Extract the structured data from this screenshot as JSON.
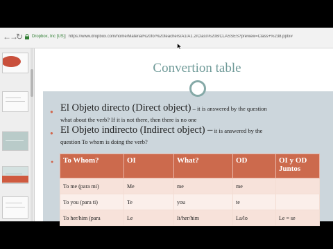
{
  "browser": {
    "back_icon": "arrow-left-icon",
    "forward_icon": "arrow-right-icon",
    "reload_icon": "reload-icon",
    "site_identity": "Dropbox, Inc [US]",
    "url": "https://www.dropbox.com/home/Material%20for%20teachers/A1/A1.2/Class%208/CLASSES?preview=Class+%238.pptx#"
  },
  "slide": {
    "title": "Convertion table",
    "bullets": [
      {
        "heading": "El Objeto directo (Direct object)",
        "tail": " – it is answered by the question",
        "line2": "what about the verb? If it is not there, then there is no one"
      },
      {
        "heading": "El Objeto indirecto (Indirect object) –",
        "tail": " it is answered by the",
        "line2": "question To whom is doing the verb?"
      }
    ],
    "table": {
      "headers": [
        "To Whom?",
        "OI",
        "What?",
        "OD",
        "OI y OD Juntos"
      ],
      "rows": [
        [
          "To me (para mi)",
          "Me",
          "me",
          "me",
          ""
        ],
        [
          "To you (para ti)",
          "Te",
          "you",
          "te",
          ""
        ],
        [
          "To her/him (para",
          "Le",
          "It/her/him",
          "La/lo",
          "Le = se"
        ]
      ]
    }
  },
  "colors": {
    "title": "#6f9a98",
    "accent": "#cc6a4d",
    "slide_background": "#ccd6dc"
  }
}
